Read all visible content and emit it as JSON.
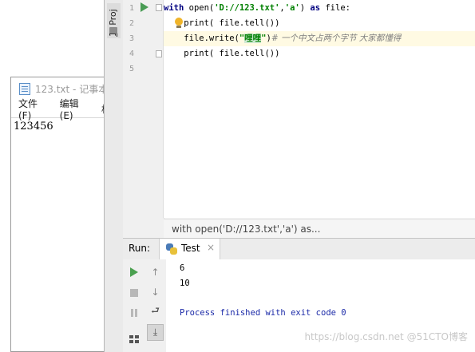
{
  "notepad": {
    "title": "123.txt - 记事本",
    "menu": [
      "文件(F)",
      "编辑(E)",
      "格"
    ],
    "content": "123456"
  },
  "ide": {
    "side_tab": {
      "number": "1",
      "label": ": Proj"
    },
    "line_numbers": [
      "1",
      "2",
      "3",
      "4",
      "5"
    ],
    "code": {
      "line1": {
        "kw_with": "with",
        "open_call": " open(",
        "path": "'D://123.txt'",
        "comma": ",",
        "mode": "'a'",
        "close_paren": ") ",
        "kw_as": "as",
        "tail": " file:"
      },
      "line2": {
        "indent": "    ",
        "text": "print( file.tell())"
      },
      "line3": {
        "indent": "    ",
        "prefix": "file.write(",
        "str_open": "\"",
        "str_sel": "哩哩",
        "str_close": "\"",
        "after": ")",
        "comment": "# 一个中文占两个字节 大家都懂得"
      },
      "line4": {
        "indent": "    ",
        "text": "print( file.tell())"
      }
    },
    "breadcrumb": "with open('D://123.txt','a') as...",
    "run_panel": {
      "label": "Run:",
      "tab_label": "Test",
      "tab_close": "×",
      "output_lines": [
        "6",
        "10"
      ],
      "exit_message": "Process finished with exit code 0"
    },
    "watermark": "https://blog.csdn.net @51CTO博客"
  },
  "colors": {
    "keyword": "#000080",
    "string": "#008000",
    "comment": "#808080",
    "exit_message": "#1b2aa8",
    "run_green": "#499c54",
    "highlight_line": "#fffae3"
  },
  "icons": {
    "notepad_title": "notepad-file-icon",
    "run_gutter": "run-arrow-icon",
    "intention": "lightbulb-icon",
    "tab": "python-icon",
    "tool_left": [
      "run-icon",
      "stop-icon",
      "pause-icon",
      "layout-icon"
    ],
    "tool_right": [
      "up-arrow-icon",
      "down-arrow-icon",
      "soft-wrap-icon",
      "scroll-to-end-icon"
    ]
  }
}
